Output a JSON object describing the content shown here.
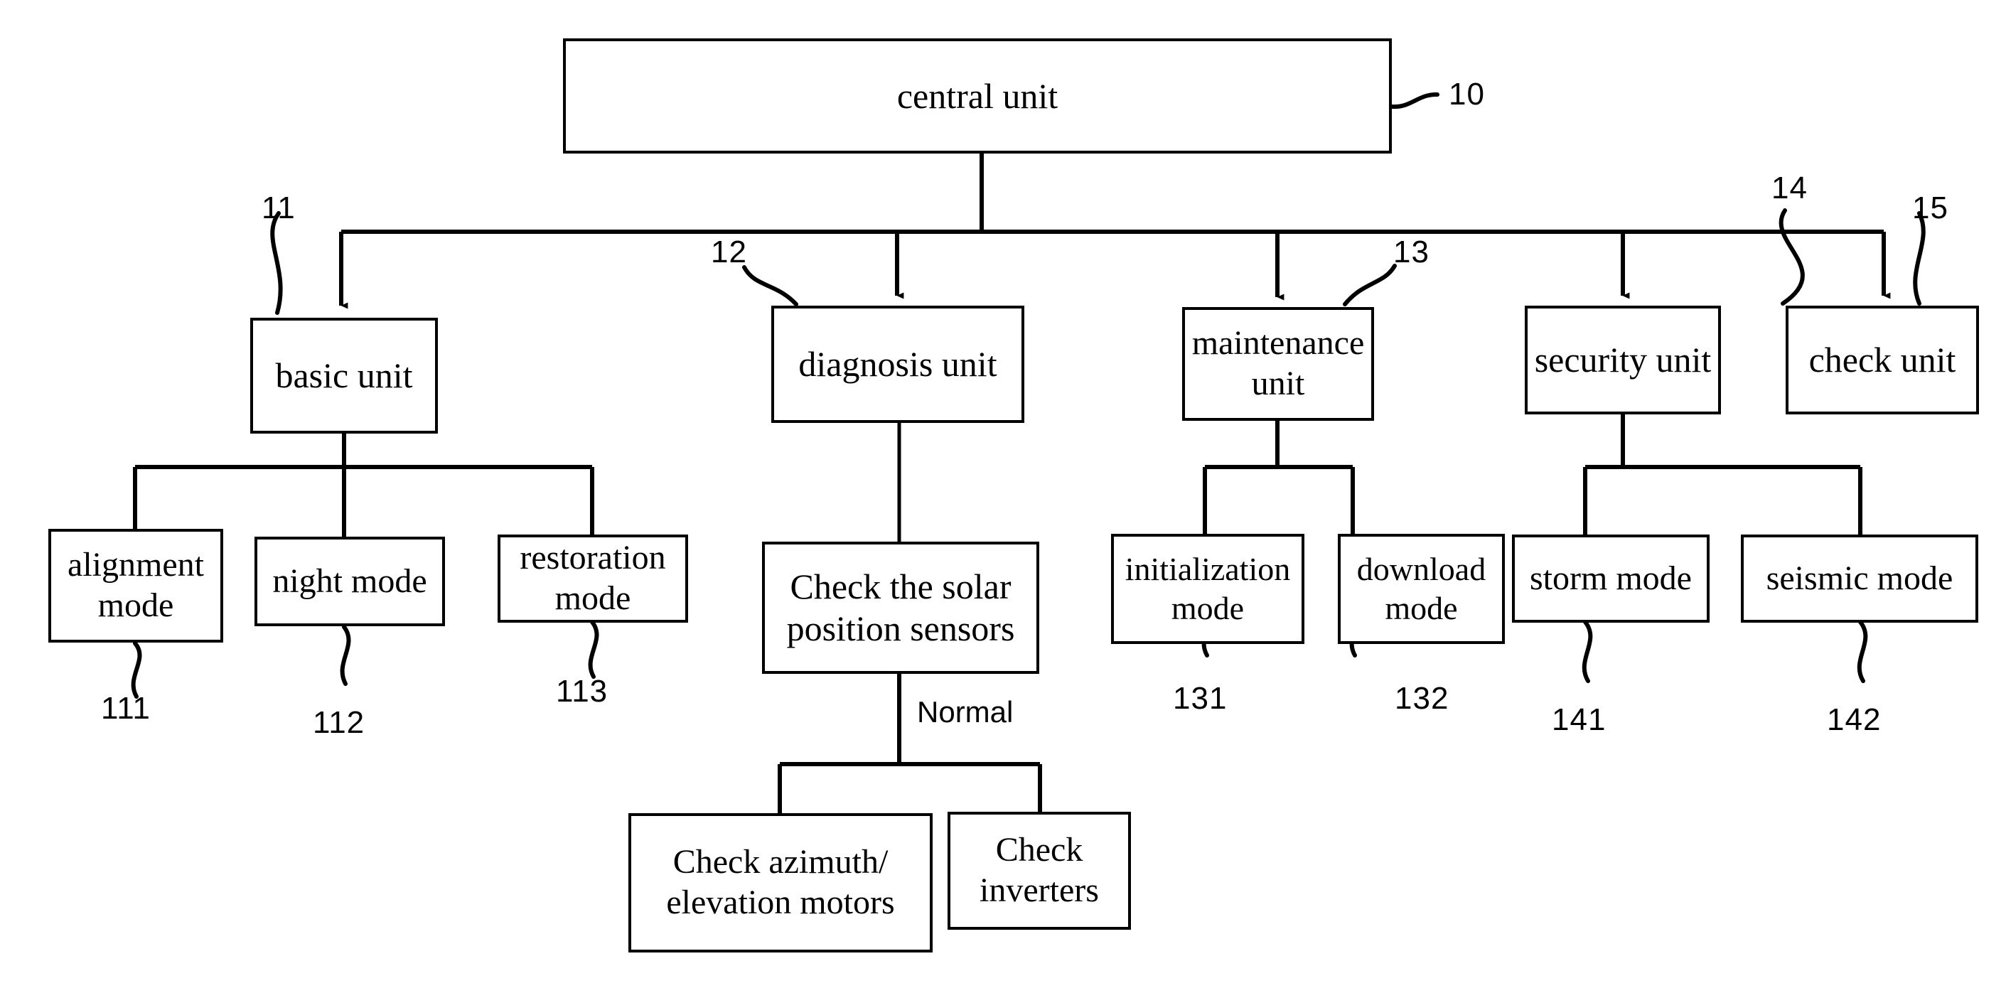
{
  "figure": {
    "type": "block-diagram",
    "title": "central unit control hierarchy",
    "line_color": "#000000",
    "background_color": "#ffffff"
  },
  "nodes": {
    "central_unit": {
      "label": "central unit"
    },
    "basic_unit": {
      "label": "basic unit"
    },
    "diagnosis_unit": {
      "label": "diagnosis unit"
    },
    "maintenance_unit": {
      "label": "maintenance\nunit"
    },
    "security_unit": {
      "label": "security unit"
    },
    "check_unit": {
      "label": "check  unit"
    },
    "alignment_mode": {
      "label": "alignment\nmode"
    },
    "night_mode": {
      "label": "night mode"
    },
    "restoration_mode": {
      "label": "restoration\nmode"
    },
    "check_solar_sensors": {
      "label": "Check the solar\nposition sensors"
    },
    "check_motors": {
      "label": "Check azimuth/\nelevation motors"
    },
    "check_inverters": {
      "label": "Check\ninverters"
    },
    "initialization_mode": {
      "label": "initialization\nmode"
    },
    "download_mode": {
      "label": "download\nmode"
    },
    "storm_mode": {
      "label": "storm mode"
    },
    "seismic_mode": {
      "label": "seismic mode"
    }
  },
  "reference_numerals": {
    "central_unit": "10",
    "basic_unit": "11",
    "diagnosis_unit": "12",
    "maintenance_unit": "13",
    "security_unit": "14",
    "check_unit": "15",
    "alignment_mode": "111",
    "night_mode": "112",
    "restoration_mode": "113",
    "initialization_mode": "131",
    "download_mode": "132",
    "storm_mode": "141",
    "seismic_mode": "142"
  },
  "edge_labels": {
    "diagnosis_normal": "Normal"
  }
}
